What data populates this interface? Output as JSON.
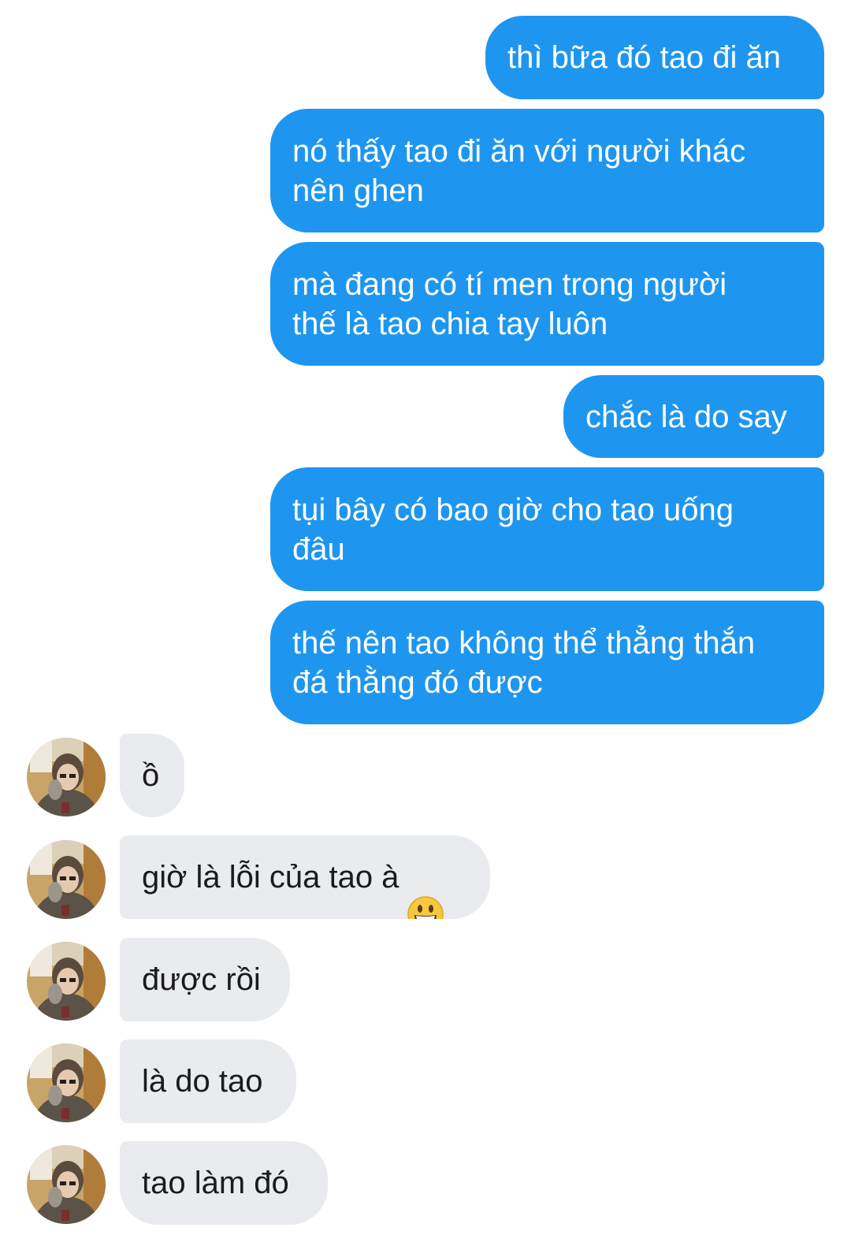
{
  "sent_messages": [
    {
      "text": "thì bữa đó tao đi ăn"
    },
    {
      "text": "nó thấy tao đi ăn với người khác\nnên ghen"
    },
    {
      "text": "mà đang có tí men trong người\nthế là tao chia tay luôn"
    },
    {
      "text": "chắc là do say"
    },
    {
      "text": "tụi bây có bao giờ cho tao uống\nđâu"
    },
    {
      "text": "thế nên tao không thể thẳng thắn\nđá thằng đó được"
    }
  ],
  "received_messages": [
    {
      "text": "ồ"
    },
    {
      "text": "giờ là lỗi của tao à",
      "emoji": "grinning-face-emoji"
    },
    {
      "text": "được rồi"
    },
    {
      "text": "là do tao"
    },
    {
      "text": "tao làm đó"
    }
  ],
  "colors": {
    "sent_bubble": "#1e96f0",
    "received_bubble": "#e9ebef",
    "sent_text": "#ffffff",
    "received_text": "#1b1b1b"
  }
}
